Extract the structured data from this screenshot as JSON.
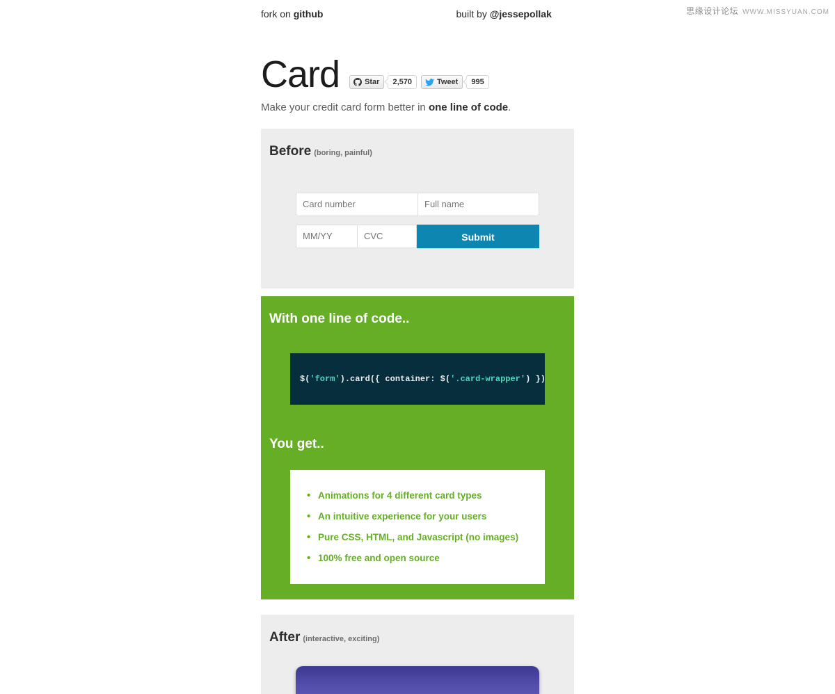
{
  "watermark": {
    "cn": "思缘设计论坛",
    "url": "WWW.MISSYUAN.COM"
  },
  "top_links": {
    "fork_prefix": "fork on ",
    "fork_target": "github",
    "built_prefix": "built by ",
    "built_author": "@jessepollak"
  },
  "header": {
    "title": "Card",
    "tagline_prefix": "Make your credit card form better in ",
    "tagline_strong": "one line of code",
    "tagline_suffix": ".",
    "social": {
      "github_label": "Star",
      "github_count": "2,570",
      "twitter_label": "Tweet",
      "twitter_count": "995",
      "github_icon": "github-mark-icon",
      "twitter_icon": "twitter-bird-icon"
    }
  },
  "before": {
    "heading": "Before",
    "subheading": "(boring, painful)",
    "fields": {
      "card_number_placeholder": "Card number",
      "full_name_placeholder": "Full name",
      "expiry_placeholder": "MM/YY",
      "cvc_placeholder": "CVC"
    },
    "submit_label": "Submit"
  },
  "oneline": {
    "heading": "With one line of code..",
    "code_parts": {
      "p1": "$(",
      "s1": "'form'",
      "p2": ").card({ container: $(",
      "s2": "'.card-wrapper'",
      "p3": ") });"
    },
    "youget_heading": "You get..",
    "features": [
      "Animations for 4 different card types",
      "An intuitive experience for your users",
      "Pure CSS, HTML, and Javascript (no images)",
      "100% free and open source"
    ]
  },
  "after": {
    "heading": "After",
    "subheading": "(interactive, exciting)"
  },
  "colors": {
    "green": "#65ae26",
    "blue": "#0d86b2",
    "code_bg": "#062e3c",
    "code_string": "#4fd8c0",
    "gray_panel": "#ededed",
    "card_purple": "#4f4aa6"
  }
}
